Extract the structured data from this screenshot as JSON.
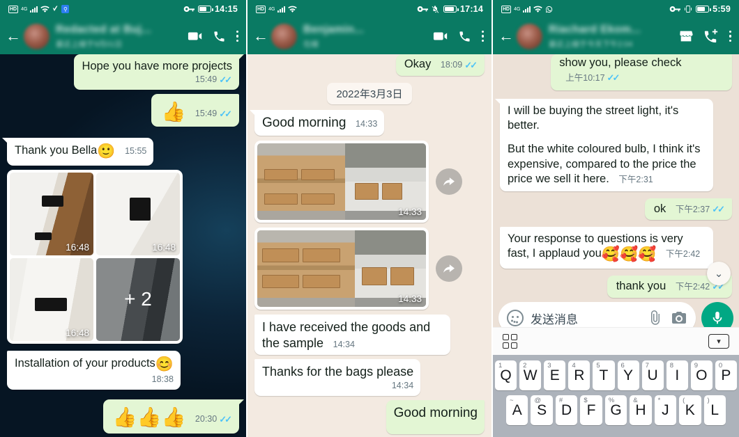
{
  "app": "WhatsApp",
  "panels": [
    {
      "id": "left",
      "status": {
        "time": "14:15",
        "hd": "HD",
        "net": "4G",
        "lock_icon": "key-icon"
      },
      "header": {
        "back_icon": "back-arrow-icon",
        "contact_name": "Redacted at Buj...",
        "contact_sub": "最近上線于9月01日",
        "icons": [
          "video-call-icon",
          "voice-call-icon",
          "overflow-menu-icon"
        ]
      },
      "messages": [
        {
          "dir": "out",
          "text": "Hope you have more projects",
          "time": "15:49",
          "ticks": "✓✓"
        },
        {
          "dir": "out",
          "emoji": "👍",
          "time": "15:49",
          "ticks": "✓✓"
        },
        {
          "dir": "in",
          "text": "Thank you Bella",
          "emoji": "🙂",
          "time": "15:55"
        },
        {
          "dir": "in",
          "type": "image-grid",
          "count_overlay": "+ 2",
          "thumbs": [
            {
              "time": "16:48"
            },
            {
              "time": "16:48"
            },
            {
              "time": "16:48"
            },
            {
              "time": "16:48"
            }
          ]
        },
        {
          "dir": "in",
          "text": "Installation of your products",
          "emoji": "😊",
          "time": "18:38"
        },
        {
          "dir": "out",
          "emoji": "👍👍👍",
          "time": "20:30",
          "ticks": "✓✓"
        }
      ]
    },
    {
      "id": "middle",
      "status": {
        "time": "17:14",
        "hd": "HD",
        "net": "4G",
        "mute_icon": "bell-off-icon",
        "lock_icon": "key-icon"
      },
      "header": {
        "back_icon": "back-arrow-icon",
        "contact_name": "Benjamin...",
        "contact_sub": "在線",
        "icons": [
          "video-call-icon",
          "voice-call-icon",
          "overflow-menu-icon"
        ]
      },
      "messages": [
        {
          "dir": "out",
          "text": "Okay",
          "time": "18:09",
          "ticks": "✓✓"
        },
        {
          "type": "date-divider",
          "label": "2022年3月3日"
        },
        {
          "dir": "in",
          "text": "Good morning",
          "time": "14:33"
        },
        {
          "dir": "in",
          "type": "photo",
          "time": "14:33",
          "forward_icon": "forward-arrow-icon"
        },
        {
          "dir": "in",
          "type": "photo",
          "time": "14:33",
          "forward_icon": "forward-arrow-icon"
        },
        {
          "dir": "in",
          "text": "I have received the goods and the sample",
          "time": "14:34"
        },
        {
          "dir": "in",
          "text": "Thanks for the bags please",
          "time": "14:34"
        },
        {
          "dir": "out",
          "text": "Good morning",
          "time": ""
        }
      ]
    },
    {
      "id": "right",
      "status": {
        "time": "5:59",
        "hd": "HD",
        "net": "4G",
        "whatsapp_icon": "whatsapp-icon",
        "lock_icon": "key-icon",
        "vibrate_icon": "vibrate-icon"
      },
      "header": {
        "back_icon": "back-arrow-icon",
        "contact_name": "Riachard Ekom...",
        "contact_sub": "最近上線于今天下午2:04",
        "icons": [
          "storefront-icon",
          "add-call-icon",
          "overflow-menu-icon"
        ]
      },
      "messages": [
        {
          "dir": "out",
          "text": "show you, please check",
          "time": "上午10:17",
          "ticks": "✓✓"
        },
        {
          "dir": "in",
          "text": "I will be buying the street light, it's better.",
          "text2": "But the white coloured bulb, I think it's expensive, compared to the price the price we sell it here.",
          "time": "下午2:31"
        },
        {
          "dir": "out",
          "text": "ok",
          "time": "下午2:37",
          "ticks": "✓✓"
        },
        {
          "dir": "in",
          "text": "Your response to questions is very fast, I applaud you",
          "emoji": "🥰🥰🥰",
          "time": "下午2:42"
        },
        {
          "dir": "out",
          "text": "thank you",
          "time": "下午2:42",
          "ticks": "✓✓"
        }
      ],
      "composer": {
        "emoji_icon": "smiley-icon",
        "placeholder": "发送消息",
        "attach_icon": "paperclip-icon",
        "camera_icon": "camera-icon",
        "mic_icon": "microphone-icon"
      },
      "scroll_down_icon": "chevron-double-down-icon",
      "keyboard": {
        "grid_icon": "apps-grid-icon",
        "collapse_icon": "collapse-keyboard-icon",
        "row1": [
          {
            "num": "1",
            "letter": "Q"
          },
          {
            "num": "2",
            "letter": "W"
          },
          {
            "num": "3",
            "letter": "E"
          },
          {
            "num": "4",
            "letter": "R"
          },
          {
            "num": "5",
            "letter": "T"
          },
          {
            "num": "6",
            "letter": "Y"
          },
          {
            "num": "7",
            "letter": "U"
          },
          {
            "num": "8",
            "letter": "I"
          },
          {
            "num": "9",
            "letter": "O"
          },
          {
            "num": "0",
            "letter": "P"
          }
        ],
        "row2": [
          {
            "num": "~",
            "letter": "A"
          },
          {
            "num": "@",
            "letter": "S"
          },
          {
            "num": "#",
            "letter": "D"
          },
          {
            "num": "$",
            "letter": "F"
          },
          {
            "num": "%",
            "letter": "G"
          },
          {
            "num": "&",
            "letter": "H"
          },
          {
            "num": "*",
            "letter": "J"
          },
          {
            "num": "(",
            "letter": "K"
          },
          {
            "num": ")",
            "letter": "L"
          }
        ]
      }
    }
  ],
  "colors": {
    "header_green": "#0a7a63",
    "outgoing_bubble": "#e3f6d4",
    "incoming_bubble": "#ffffff",
    "tick_blue": "#4fc3f7",
    "mic_green": "#00a884",
    "cream_bg": "#f3eae1",
    "dark_bg": "#07121f"
  }
}
